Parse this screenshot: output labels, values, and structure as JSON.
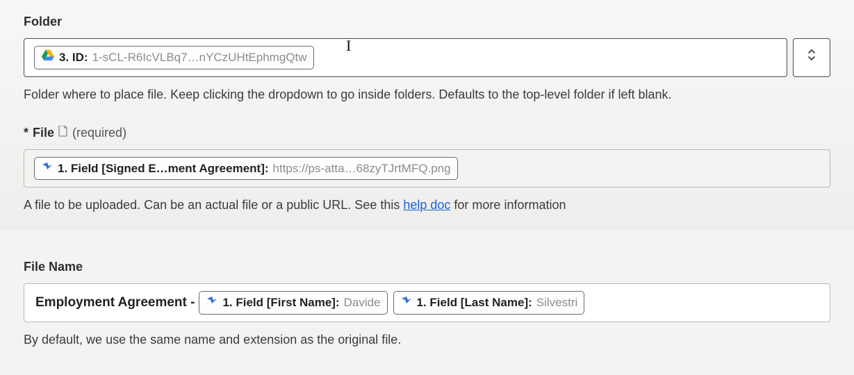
{
  "folder": {
    "label": "Folder",
    "token": {
      "icon": "gdrive",
      "label": "3. ID:",
      "value": "1-sCL-R6IcVLBq7…nYCzUHtEphmgQtw"
    },
    "help": "Folder where to place file. Keep clicking the dropdown to go inside folders. Defaults to the top-level folder if left blank."
  },
  "file": {
    "asterisk": "*",
    "label": "File",
    "required": "(required)",
    "token": {
      "icon": "zap",
      "label": "1. Field [Signed E…ment Agreement]:",
      "value": "https://ps-atta…68zyTJrtMFQ.png"
    },
    "help_before": "A file to be uploaded. Can be an actual file or a public URL. See this ",
    "help_link": "help doc",
    "help_after": " for more information"
  },
  "filename": {
    "label": "File Name",
    "prefix_text": "Employment Agreement - ",
    "tokens": [
      {
        "icon": "zap",
        "label": "1. Field [First Name]:",
        "value": "Davide"
      },
      {
        "icon": "zap",
        "label": "1. Field [Last Name]:",
        "value": "Silvestri"
      }
    ],
    "help": "By default, we use the same name and extension as the original file."
  }
}
